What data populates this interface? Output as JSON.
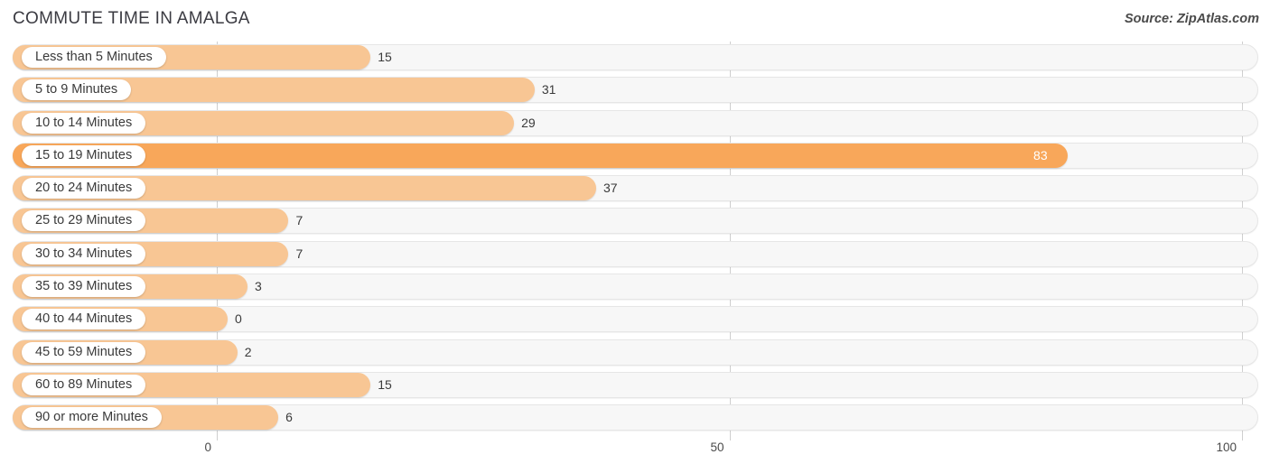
{
  "header": {
    "title": "COMMUTE TIME IN AMALGA",
    "source": "Source: ZipAtlas.com"
  },
  "colors": {
    "bar": "#f8c694",
    "bar_highlight": "#f8a75a",
    "track": "#f7f7f7",
    "track_border": "#e6e6e6",
    "gridline": "#cfcfcf",
    "text": "#3a3a3a"
  },
  "chart_data": {
    "type": "bar",
    "orientation": "horizontal",
    "title": "COMMUTE TIME IN AMALGA",
    "xlabel": "",
    "ylabel": "",
    "xlim": [
      0,
      100
    ],
    "grid": true,
    "legend": false,
    "ticks": [
      "0",
      "50",
      "100"
    ],
    "tick_values": [
      0,
      50,
      100
    ],
    "categories": [
      "Less than 5 Minutes",
      "5 to 9 Minutes",
      "10 to 14 Minutes",
      "15 to 19 Minutes",
      "20 to 24 Minutes",
      "25 to 29 Minutes",
      "30 to 34 Minutes",
      "35 to 39 Minutes",
      "40 to 44 Minutes",
      "45 to 59 Minutes",
      "60 to 89 Minutes",
      "90 or more Minutes"
    ],
    "values": [
      15,
      31,
      29,
      83,
      37,
      7,
      7,
      3,
      0,
      2,
      15,
      6
    ],
    "value_labels": [
      "15",
      "31",
      "29",
      "83",
      "37",
      "7",
      "7",
      "3",
      "0",
      "2",
      "15",
      "6"
    ],
    "highlight_index": 3
  }
}
